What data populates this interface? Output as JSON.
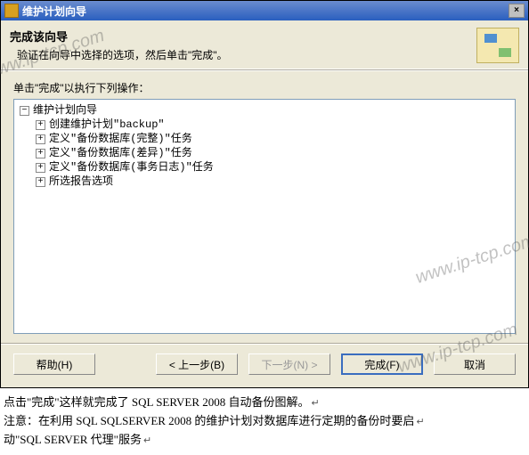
{
  "window": {
    "title": "维护计划向导"
  },
  "header": {
    "title": "完成该向导",
    "description": "验证在向导中选择的选项，然后单击\"完成\"。"
  },
  "instruction": "单击\"完成\"以执行下列操作：",
  "tree": {
    "root": "维护计划向导",
    "items": [
      "创建维护计划\"backup\"",
      "定义\"备份数据库(完整)\"任务",
      "定义\"备份数据库(差异)\"任务",
      "定义\"备份数据库(事务日志)\"任务",
      "所选报告选项"
    ]
  },
  "buttons": {
    "help": "帮助(H)",
    "back": "< 上一步(B)",
    "next": "下一步(N) >",
    "finish": "完成(F)",
    "cancel": "取消"
  },
  "notes": {
    "line1": "点击\"完成\"这样就完成了 SQL SERVER 2008 自动备份图解。",
    "line2": "注意：在利用 SQL SQLSERVER 2008 的维护计划对数据库进行定期的备份时要启",
    "line3": "动\"SQL SERVER 代理\"服务"
  },
  "watermark": "www.ip-tcp.com"
}
